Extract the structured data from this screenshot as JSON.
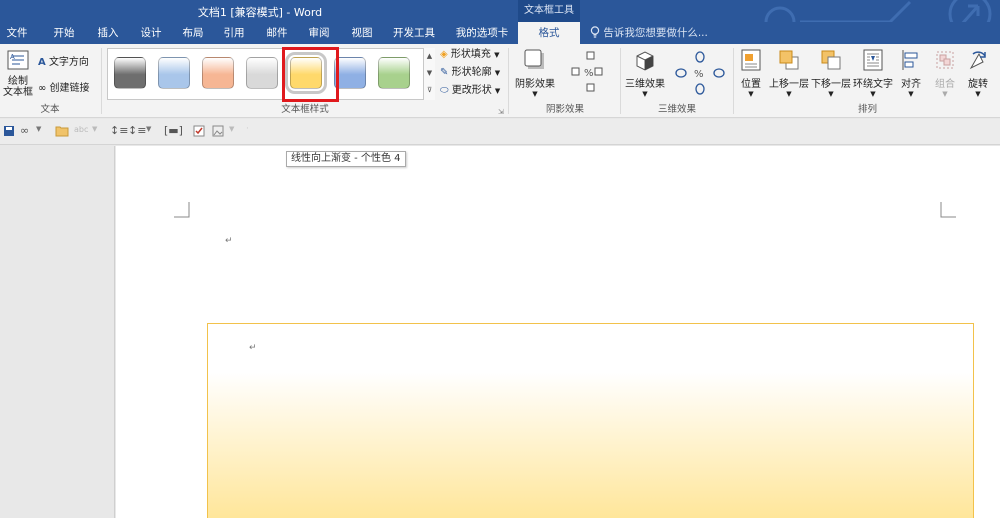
{
  "window": {
    "title": "文档1 [兼容模式] - Word",
    "context_tab_group": "文本框工具"
  },
  "tabs": [
    {
      "label": "文件"
    },
    {
      "label": "开始"
    },
    {
      "label": "插入"
    },
    {
      "label": "设计"
    },
    {
      "label": "布局"
    },
    {
      "label": "引用"
    },
    {
      "label": "邮件"
    },
    {
      "label": "审阅"
    },
    {
      "label": "视图"
    },
    {
      "label": "开发工具"
    },
    {
      "label": "我的选项卡"
    },
    {
      "label": "格式"
    }
  ],
  "tell_me": {
    "placeholder": "告诉我您想要做什么..."
  },
  "ribbon": {
    "text_group": {
      "label": "文本",
      "draw_textbox": "绘制\n文本框",
      "text_direction": "文字方向",
      "create_link": "创建链接"
    },
    "styles_group": {
      "label": "文本框样式",
      "swatches": [
        {
          "color": "#6e6e6e"
        },
        {
          "color": "#a9c6ea"
        },
        {
          "color": "#f6b694"
        },
        {
          "color": "#d9d9d9"
        },
        {
          "color": "#ffd96b"
        },
        {
          "color": "#8fb0e4"
        },
        {
          "color": "#a8d18d"
        }
      ],
      "selected_index": 4,
      "shape_fill": "形状填充",
      "shape_outline": "形状轮廓",
      "change_shape": "更改形状"
    },
    "shadow_group": {
      "label": "阴影效果",
      "button": "阴影效果"
    },
    "threed_group": {
      "label": "三维效果",
      "button": "三维效果"
    },
    "arrange_group": {
      "label": "排列",
      "position": "位置",
      "bring_forward": "上移一层",
      "send_backward": "下移一层",
      "wrap_text": "环绕文字",
      "align": "对齐",
      "group": "组合",
      "rotate": "旋转"
    }
  },
  "qat": {
    "items": [
      "save-icon",
      "link-icon",
      "folder-icon",
      "ruler-icon",
      "spacing-icon",
      "bracket-icon",
      "checkbox-icon",
      "image-icon"
    ]
  },
  "tooltip": {
    "text": "线性向上渐变 - 个性色 4"
  },
  "document": {
    "paragraph_mark": "↵",
    "textbox_gradient": [
      "#ffffff",
      "#ffe69a"
    ]
  }
}
